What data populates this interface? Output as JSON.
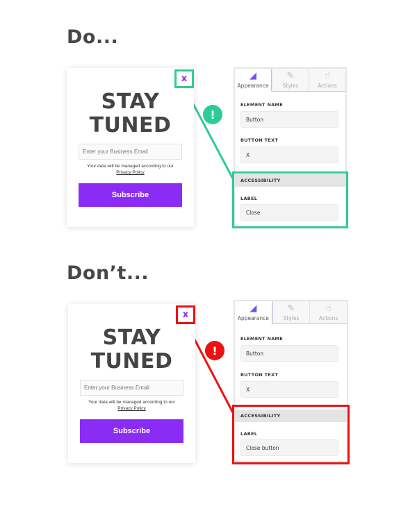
{
  "colors": {
    "good": "#2ecc95",
    "bad": "#ee1111",
    "brand_purple": "#8b2cf5",
    "heading": "#484848"
  },
  "examples": [
    {
      "heading": "Do...",
      "status": "good",
      "alert_icon": "exclamation-icon",
      "popup": {
        "close_label": "x",
        "title_line1": "STAY",
        "title_line2": "TUNED",
        "email_placeholder": "Enter your Business Email",
        "note": "Your data will be managed according to our",
        "privacy_link": "Privacy Policy",
        "subscribe_label": "Subscribe"
      },
      "panel": {
        "tabs": [
          {
            "label": "Appearance",
            "icon": "set-square-icon",
            "active": true
          },
          {
            "label": "Styles",
            "icon": "brush-icon",
            "active": false
          },
          {
            "label": "Actions",
            "icon": "pointer-hand-icon",
            "active": false
          }
        ],
        "element_name_label": "ELEMENT NAME",
        "element_name_value": "Button",
        "button_text_label": "BUTTON TEXT",
        "button_text_value": "X",
        "accessibility_header": "ACCESSIBILITY",
        "label_label": "LABEL",
        "label_value": "Close"
      }
    },
    {
      "heading": "Don’t...",
      "status": "bad",
      "alert_icon": "exclamation-icon",
      "popup": {
        "close_label": "x",
        "title_line1": "STAY",
        "title_line2": "TUNED",
        "email_placeholder": "Enter your Business Email",
        "note": "Your data will be managed according to our",
        "privacy_link": "Privacy Policy",
        "subscribe_label": "Subscribe"
      },
      "panel": {
        "tabs": [
          {
            "label": "Appearance",
            "icon": "set-square-icon",
            "active": true
          },
          {
            "label": "Styles",
            "icon": "brush-icon",
            "active": false
          },
          {
            "label": "Actions",
            "icon": "pointer-hand-icon",
            "active": false
          }
        ],
        "element_name_label": "ELEMENT NAME",
        "element_name_value": "Button",
        "button_text_label": "BUTTON TEXT",
        "button_text_value": "X",
        "accessibility_header": "ACCESSIBILITY",
        "label_label": "LABEL",
        "label_value": "Close button"
      }
    }
  ]
}
